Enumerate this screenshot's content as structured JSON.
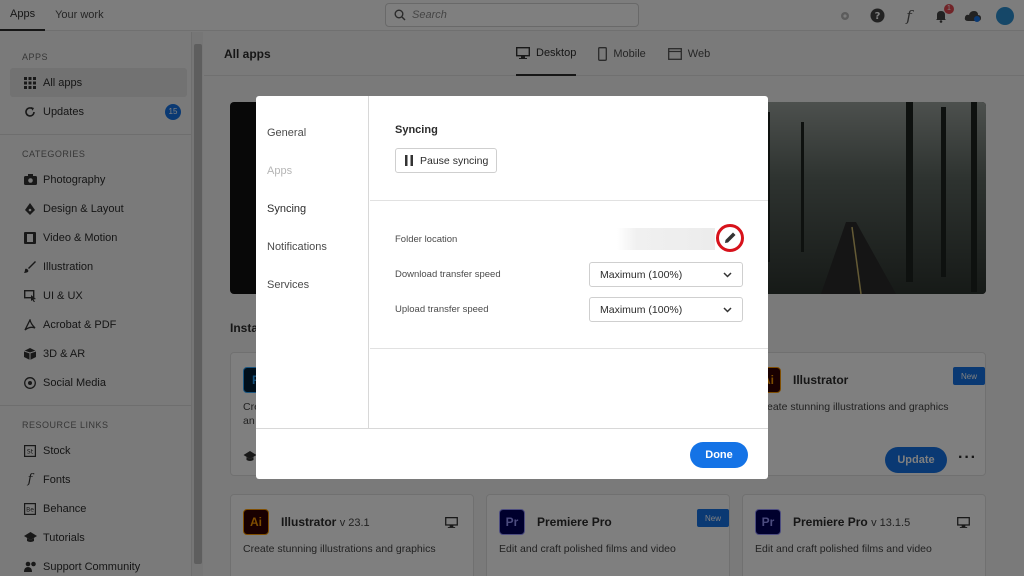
{
  "topbar": {
    "tabs": [
      "Apps",
      "Your work"
    ],
    "search_placeholder": "Search",
    "notification_count": "1"
  },
  "sidebar": {
    "apps_header": "APPS",
    "apps_items": [
      {
        "label": "All apps",
        "icon": "grid-icon"
      },
      {
        "label": "Updates",
        "icon": "refresh-icon",
        "count": "15"
      }
    ],
    "categories_header": "CATEGORIES",
    "categories": [
      {
        "label": "Photography",
        "icon": "camera-icon"
      },
      {
        "label": "Design & Layout",
        "icon": "pen-tool-icon"
      },
      {
        "label": "Video & Motion",
        "icon": "film-icon"
      },
      {
        "label": "Illustration",
        "icon": "brush-icon"
      },
      {
        "label": "UI & UX",
        "icon": "ui-icon"
      },
      {
        "label": "Acrobat & PDF",
        "icon": "acrobat-icon"
      },
      {
        "label": "3D & AR",
        "icon": "cube-icon"
      },
      {
        "label": "Social Media",
        "icon": "social-icon"
      }
    ],
    "resources_header": "RESOURCE LINKS",
    "resources": [
      {
        "label": "Stock",
        "icon": "stock-icon"
      },
      {
        "label": "Fonts",
        "icon": "fonts-icon"
      },
      {
        "label": "Behance",
        "icon": "behance-icon"
      },
      {
        "label": "Tutorials",
        "icon": "tutorials-icon"
      },
      {
        "label": "Support Community",
        "icon": "community-icon"
      }
    ]
  },
  "main": {
    "title": "All apps",
    "platform_tabs": [
      "Desktop",
      "Mobile",
      "Web"
    ],
    "installed_label": "Insta",
    "cards": {
      "ps_desc_1": "Cre",
      "ps_desc_2": "an",
      "illustrator_top": {
        "name": "Illustrator",
        "desc": "eate stunning illustrations and graphics",
        "badge": "New",
        "action": "Update"
      },
      "illustrator_bottom": {
        "name": "Illustrator",
        "version": "v 23.1",
        "desc": "Create stunning illustrations and graphics"
      },
      "premiere_new": {
        "name": "Premiere Pro",
        "desc": "Edit and craft polished films and video",
        "badge": "New"
      },
      "premiere_old": {
        "name": "Premiere Pro",
        "version": "v 13.1.5",
        "desc": "Edit and craft polished films and video"
      }
    }
  },
  "dialog": {
    "nav": [
      "General",
      "Apps",
      "Syncing",
      "Notifications",
      "Services"
    ],
    "section_title": "Syncing",
    "pause_label": "Pause syncing",
    "folder_label": "Folder location",
    "download_label": "Download transfer speed",
    "download_value": "Maximum (100%)",
    "upload_label": "Upload transfer speed",
    "upload_value": "Maximum (100%)",
    "done_label": "Done"
  },
  "colors": {
    "accent": "#1473e6",
    "highlight_ring": "#d7121b"
  }
}
